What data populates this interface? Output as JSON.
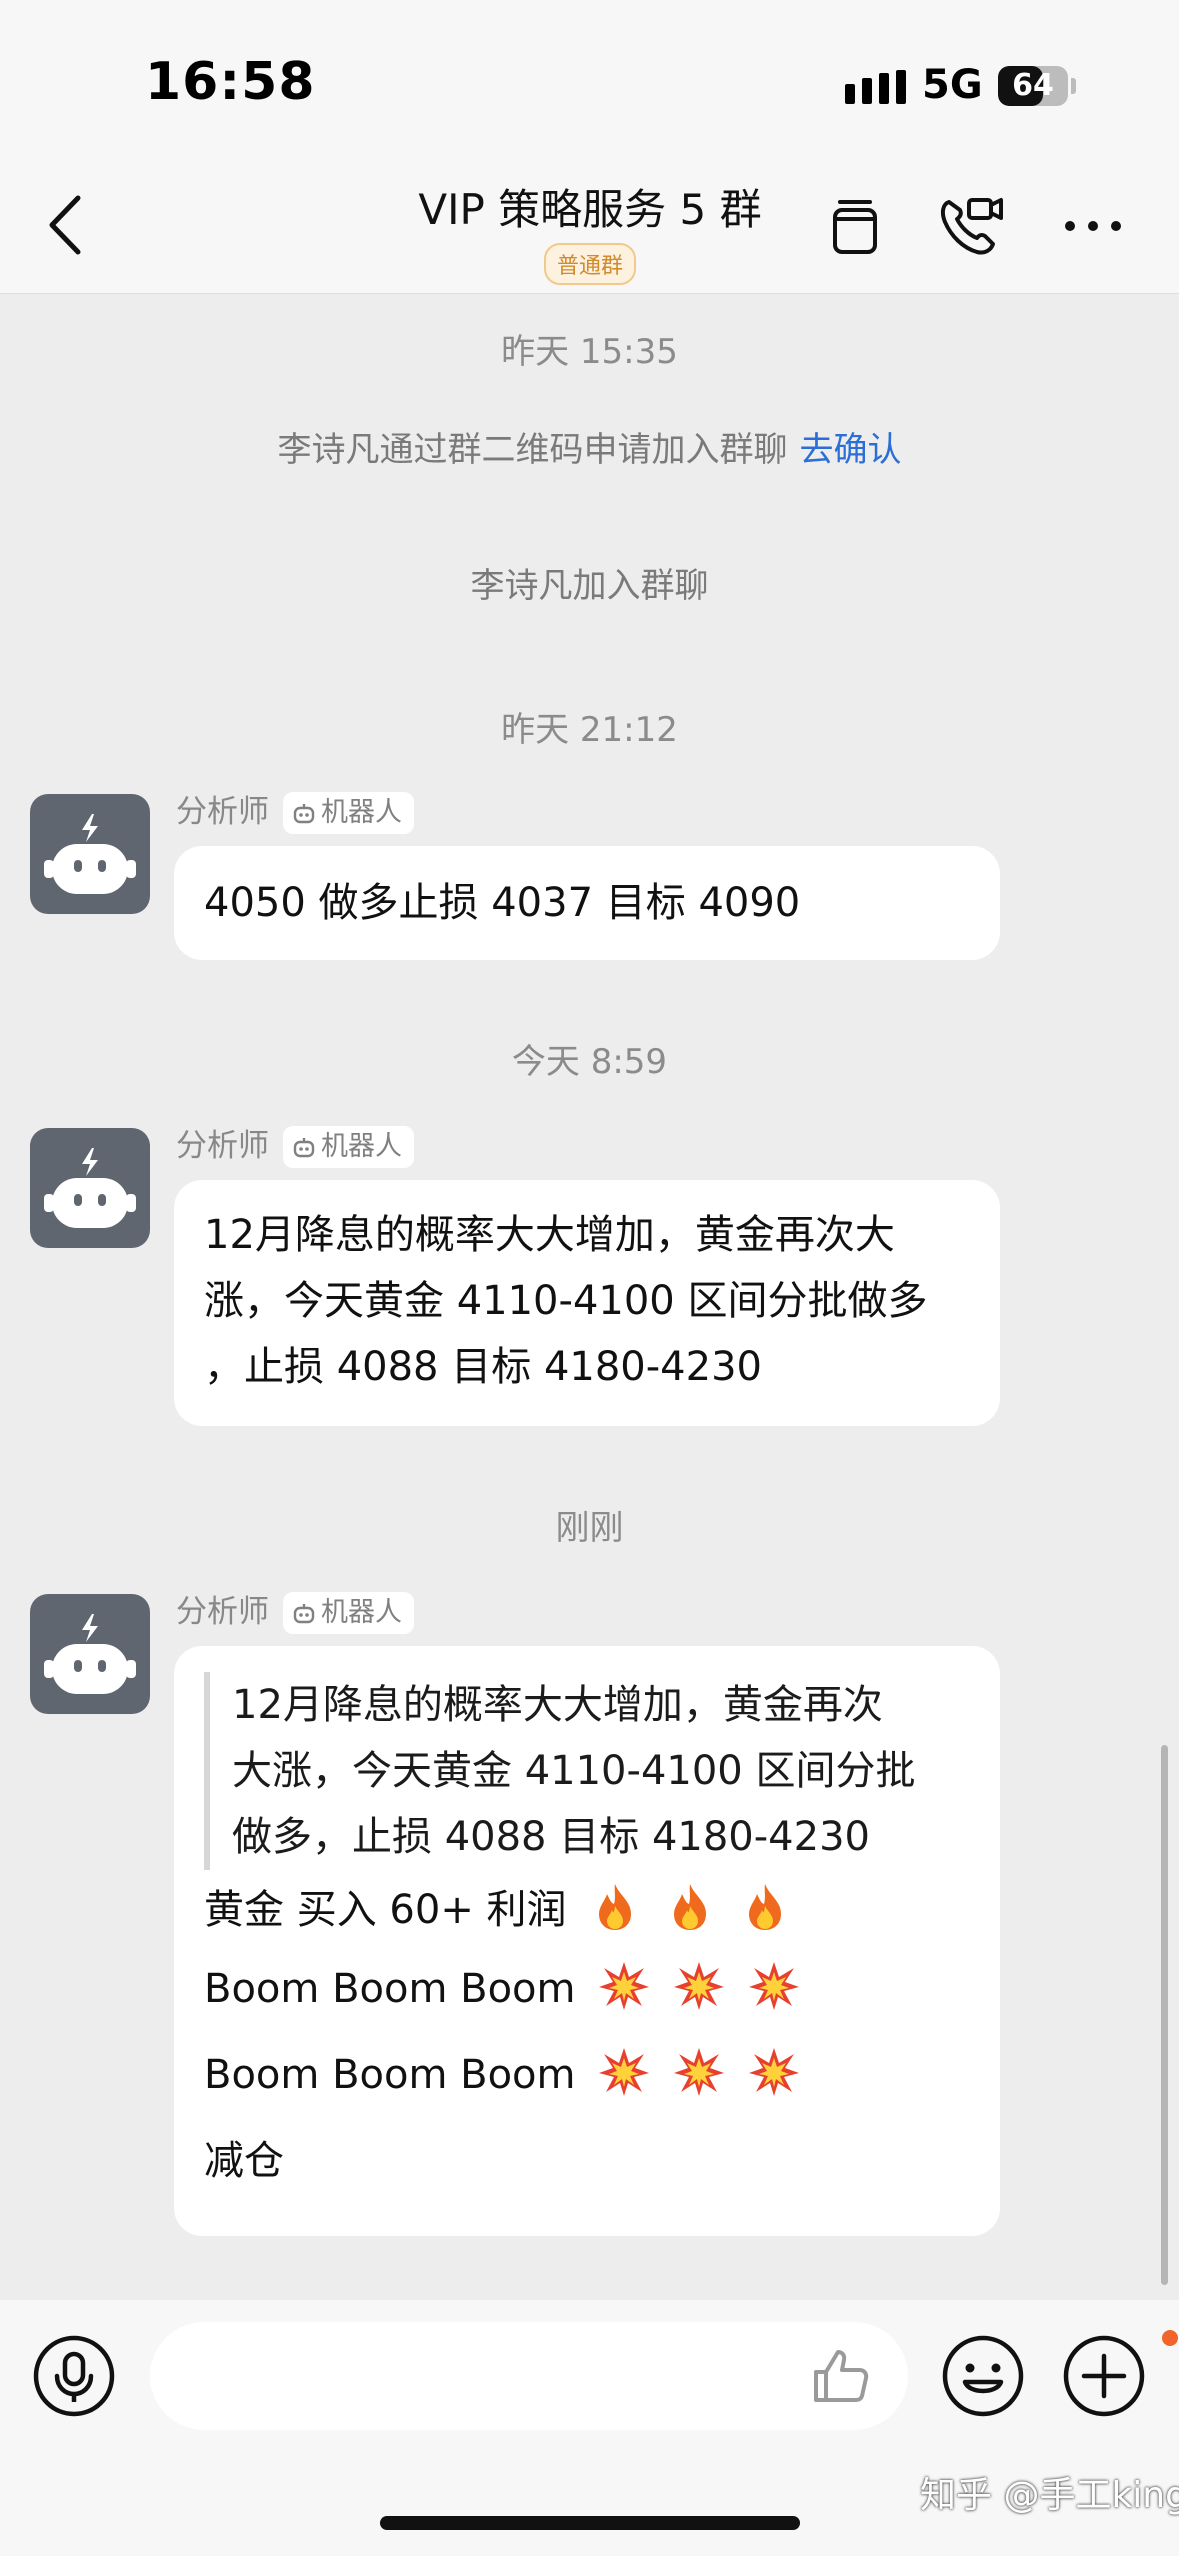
{
  "status_bar": {
    "time": "16:58",
    "network": "5G",
    "battery": "64",
    "battery_level": 0.64
  },
  "header": {
    "title": "VIP 策略服务 5 群",
    "group_tag": "普通群"
  },
  "chat": {
    "sys1_time": "昨天 15:35",
    "sys1_text": "李诗凡通过群二维码申请加入群聊",
    "sys1_link": "去确认",
    "sys2_text": "李诗凡加入群聊",
    "sys3_time": "昨天 21:12",
    "msg1": {
      "sender": "分析师",
      "badge": "机器人",
      "text": "4050 做多止损 4037 目标 4090"
    },
    "sys4_time": "今天 8:59",
    "msg2": {
      "sender": "分析师",
      "badge": "机器人",
      "lines": [
        "12月降息的概率大大增加，黄金再次大",
        "涨，今天黄金 4110-4100 区间分批做多",
        "，止损 4088 目标 4180-4230"
      ]
    },
    "sys5_time": "刚刚",
    "msg3": {
      "sender": "分析师",
      "badge": "机器人",
      "quote_lines": [
        "12月降息的概率大大增加，黄金再次",
        "大涨，今天黄金 4110-4100 区间分批",
        "做多，止损 4088 目标 4180-4230"
      ],
      "line1": "黄金 买入 60+ 利润",
      "line2": "Boom Boom Boom",
      "line3": "Boom Boom Boom",
      "line4": "减仓"
    }
  },
  "watermark": "知乎 @手工king",
  "colors": {
    "link": "#2b6fd6",
    "tag": "#d18a2c",
    "avatar": "#5f666f",
    "notification_dot": "#f1642c"
  },
  "icons": [
    "back-icon",
    "copy-icon",
    "video-call-icon",
    "more-icon",
    "robot-icon",
    "fire-icon",
    "boom-icon",
    "voice-icon",
    "thumbs-up-icon",
    "emoji-icon",
    "plus-icon"
  ]
}
